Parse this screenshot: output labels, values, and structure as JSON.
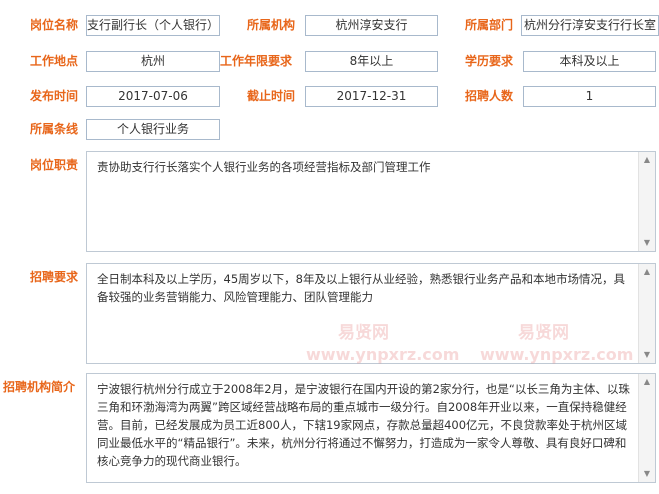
{
  "row1": {
    "position_label": "岗位名称",
    "position_value": "支行副行长（个人银行）",
    "org_label": "所属机构",
    "org_value": "杭州淳安支行",
    "dept_label": "所属部门",
    "dept_value": "杭州分行淳安支行行长室"
  },
  "row2": {
    "location_label": "工作地点",
    "location_value": "杭州",
    "years_label": "工作年限要求",
    "years_value": "8年以上",
    "edu_label": "学历要求",
    "edu_value": "本科及以上"
  },
  "row3": {
    "publish_label": "发布时间",
    "publish_value": "2017-07-06",
    "deadline_label": "截止时间",
    "deadline_value": "2017-12-31",
    "headcount_label": "招聘人数",
    "headcount_value": "1"
  },
  "row4": {
    "line_label": "所属条线",
    "line_value": "个人银行业务"
  },
  "duties": {
    "label": "岗位职责",
    "text": "责协助支行行长落实个人银行业务的各项经营指标及部门管理工作"
  },
  "requirements": {
    "label": "招聘要求",
    "text": "全日制本科及以上学历，45周岁以下，8年及以上银行从业经验，熟悉银行业务产品和本地市场情况，具备较强的业务营销能力、风险管理能力、团队管理能力"
  },
  "org_intro": {
    "label": "招聘机构简介",
    "text": "宁波银行杭州分行成立于2008年2月，是宁波银行在国内开设的第2家分行，也是“以长三角为主体、以珠三角和环渤海湾为两翼”跨区域经营战略布局的重点城市一级分行。自2008年开业以来，一直保持稳健经营。目前，已经发展成为员工近800人，下辖19家网点，存款总量超400亿元，不良贷款率处于杭州区域同业最低水平的“精品银行”。未来，杭州分行将通过不懈努力，打造成为一家令人尊敬、具有良好口碑和核心竞争力的现代商业银行。"
  },
  "watermarks": {
    "cn_1": "易贤网",
    "cn_2": "易贤网",
    "url_1": "www.ynpxrz.com",
    "url_2": "www.ynpxrz.com"
  },
  "icons": {
    "scroll_up": "▲",
    "scroll_down": "▼"
  }
}
